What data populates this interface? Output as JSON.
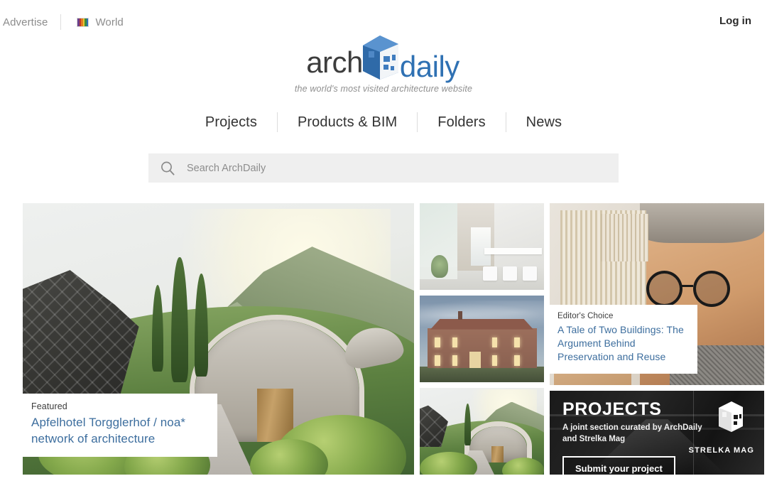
{
  "topbar": {
    "advertise": "Advertise",
    "world": "World",
    "login": "Log in",
    "flag_colors": [
      "#6b3f8c",
      "#c0392b",
      "#e07b22",
      "#e8c531",
      "#3d8b3d",
      "#2f6fb5"
    ]
  },
  "logo": {
    "word_1": "arch",
    "word_2": "daily",
    "tagline": "the world's most visited architecture website",
    "color_dark": "#3d3d3d",
    "color_blue": "#2f71b3"
  },
  "nav": {
    "items": [
      {
        "label": "Projects"
      },
      {
        "label": "Products & BIM"
      },
      {
        "label": "Folders"
      },
      {
        "label": "News"
      }
    ]
  },
  "search": {
    "placeholder": "Search ArchDaily",
    "value": "",
    "icon": "search-icon"
  },
  "grid": {
    "hero": {
      "kicker": "Featured",
      "title": "Apfelhotel Torgglerhof / noa* network of architecture",
      "alt": "Grass-roofed hotel with concrete arch entrance in alpine valley"
    },
    "thumbnails": [
      {
        "alt": "Bright white interior with long table and stools"
      },
      {
        "alt": "Brick farmhouse at dusk with lit windows"
      },
      {
        "alt": "Green hill hotel with concrete arch entry"
      }
    ],
    "editors_choice": {
      "kicker": "Editor's Choice",
      "title": "A Tale of Two Buildings: The Argument Behind Preservation and Reuse",
      "alt": "Architect with round black glasses holding a building model"
    },
    "banner": {
      "title": "PROJECTS",
      "subtitle": "A joint section curated by ArchDaily and Strelka Mag",
      "button": "Submit your project",
      "partner": "STRELKA MAG"
    }
  }
}
